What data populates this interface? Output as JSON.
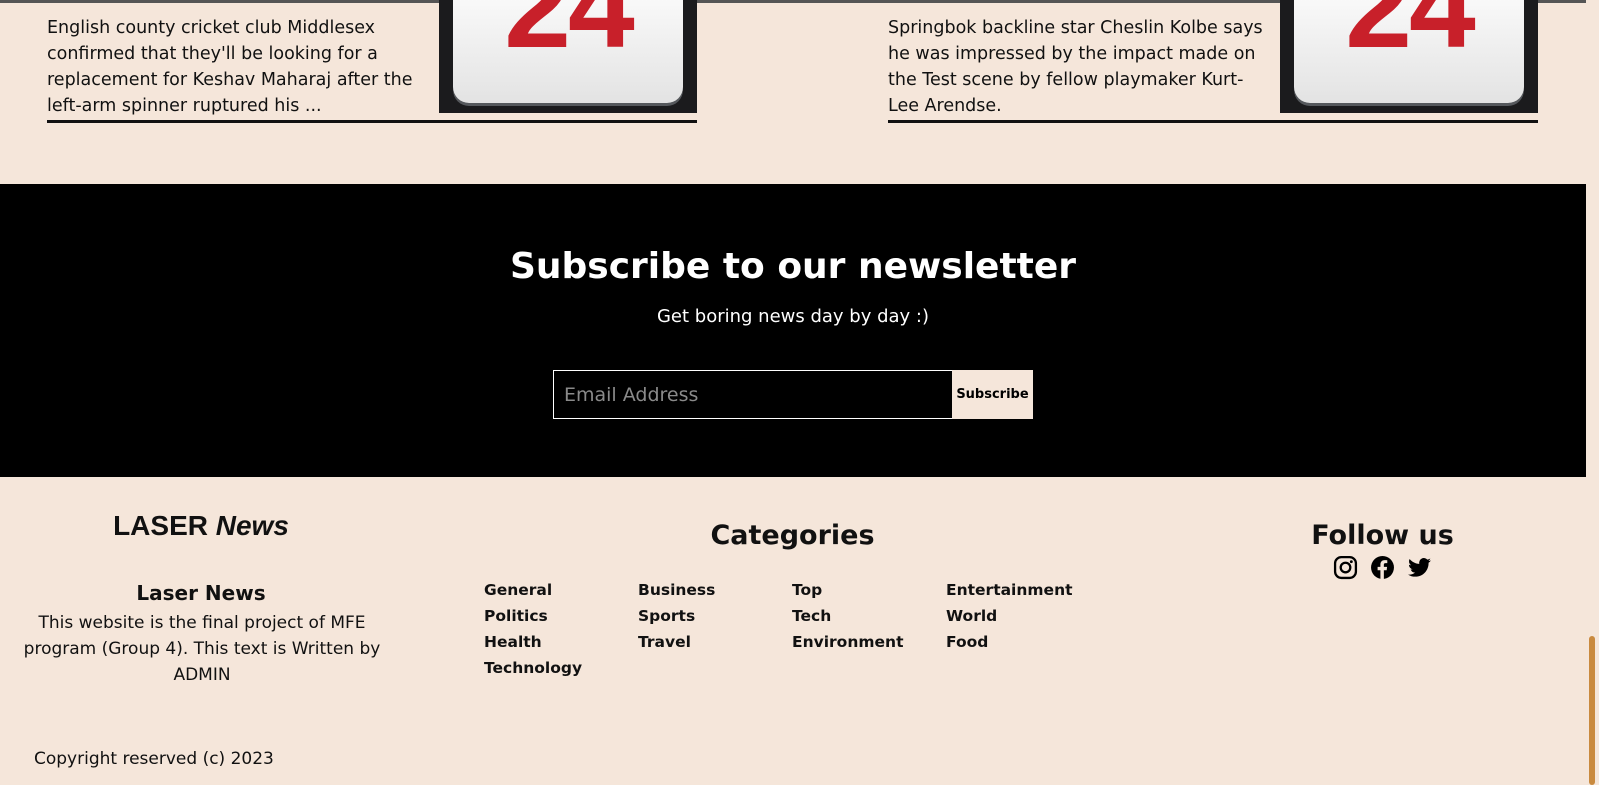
{
  "articles": [
    {
      "excerpt": "English county cricket club Middlesex confirmed that they'll be looking for a replacement for Keshav Maharaj after the left-arm spinner ruptured his ...",
      "thumbnail_text": "24"
    },
    {
      "excerpt": "Springbok backline star Cheslin Kolbe says he was impressed by the impact made on the Test scene by fellow playmaker Kurt-Lee Arendse.",
      "thumbnail_text": "24"
    }
  ],
  "newsletter": {
    "title": "Subscribe to our newsletter",
    "subtitle": "Get boring news day by day :)",
    "email_placeholder": "Email Address",
    "subscribe_label": "Subscribe"
  },
  "footer": {
    "brand_main": "LASER",
    "brand_accent": "News",
    "about_title": "Laser News",
    "about_text": "This website is the final project of MFE program (Group 4). This text is Written by ADMIN",
    "categories_title": "Categories",
    "categories": [
      "General",
      "Business",
      "Top",
      "Entertainment",
      "Politics",
      "Sports",
      "Tech",
      "World",
      "Health",
      "Travel",
      "Environment",
      "Food",
      "Technology"
    ],
    "follow_title": "Follow us",
    "social_icons": [
      "instagram-icon",
      "facebook-icon",
      "twitter-icon"
    ],
    "copyright": "Copyright reserved (c) 2023"
  },
  "colors": {
    "page_background": "#f5e6da",
    "newsletter_background": "#000000",
    "calendar_red": "#c8202a",
    "scroll_thumb": "#c98a3f"
  }
}
